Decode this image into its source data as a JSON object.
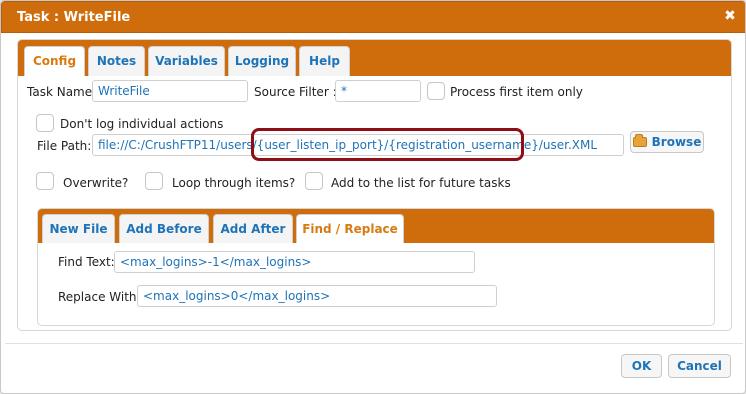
{
  "dialog": {
    "title": "Task : WriteFile",
    "close_glyph": "✖"
  },
  "tabs": [
    {
      "label": "Config",
      "active": true
    },
    {
      "label": "Notes"
    },
    {
      "label": "Variables"
    },
    {
      "label": "Logging"
    },
    {
      "label": "Help"
    }
  ],
  "config": {
    "task_name_label": "Task Name:",
    "task_name_value": "WriteFile",
    "source_filter_label": "Source Filter :",
    "source_filter_value": "*",
    "process_first_label": "Process first item only",
    "dont_log_label": "Don't log individual actions",
    "file_path_label": "File Path:",
    "file_path_value": "file://C:/CrushFTP11/users/{user_listen_ip_port}/{registration_username}/user.XML",
    "browse_label": "Browse",
    "overwrite_label": "Overwrite?",
    "loop_label": "Loop through items?",
    "add_list_label": "Add to the list for future tasks"
  },
  "inner_tabs": [
    {
      "label": "New File"
    },
    {
      "label": "Add Before"
    },
    {
      "label": "Add After"
    },
    {
      "label": "Find / Replace",
      "active": true
    }
  ],
  "find_replace": {
    "find_label": "Find Text:",
    "find_value": "<max_logins>-1</max_logins>",
    "replace_label": "Replace With:",
    "replace_value": "<max_logins>0</max_logins>"
  },
  "footer": {
    "ok_label": "OK",
    "cancel_label": "Cancel"
  },
  "colors": {
    "accent": "#cf6d0c",
    "link": "#1f73b7",
    "highlight": "#8f0e16"
  },
  "icons": {
    "close": "close-icon",
    "browse": "folder-icon"
  }
}
